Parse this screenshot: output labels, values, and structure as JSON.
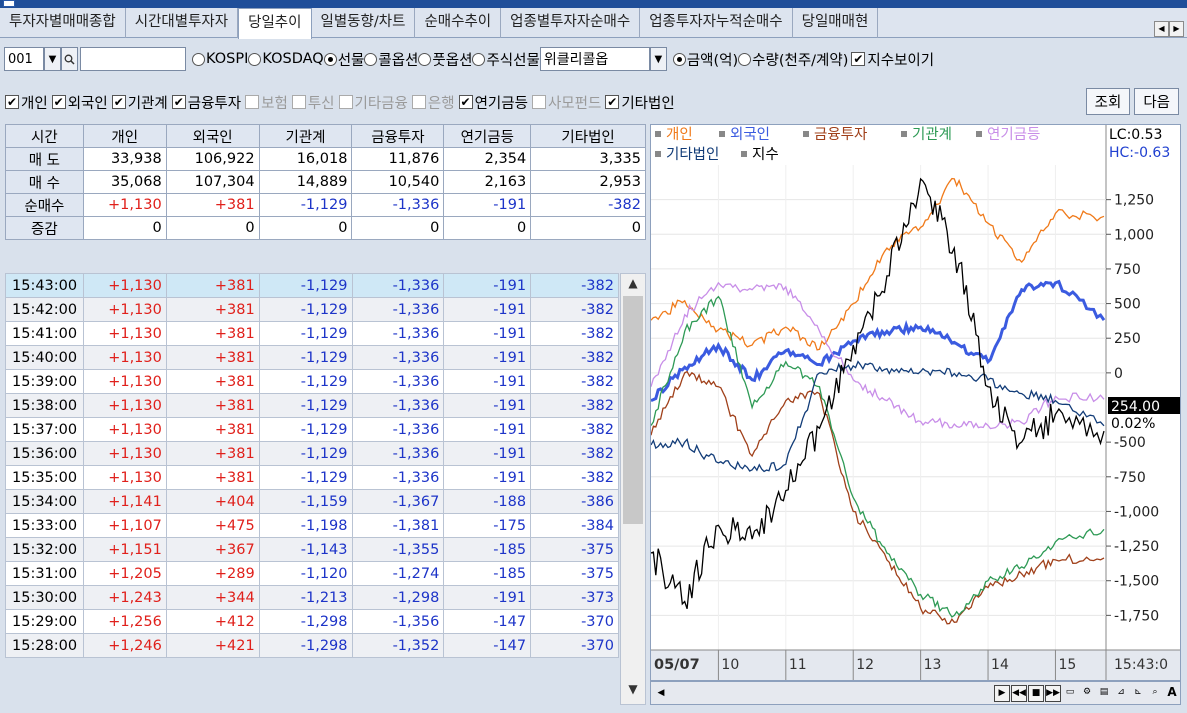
{
  "tabs": [
    "투자자별매매종합",
    "시간대별투자자",
    "당일추이",
    "일별동향/차트",
    "순매수추이",
    "업종별투자자순매수",
    "업종투자자누적순매수",
    "당일매매현"
  ],
  "active_tab_index": 2,
  "controls": {
    "code_value": "001",
    "code_name_value": "",
    "market_radios": [
      {
        "label": "KOSPI",
        "checked": false
      },
      {
        "label": "KOSDAQ",
        "checked": false
      },
      {
        "label": "선물",
        "checked": true
      },
      {
        "label": "콜옵션",
        "checked": false
      },
      {
        "label": "풋옵션",
        "checked": false
      },
      {
        "label": "주식선물",
        "checked": false
      }
    ],
    "weekly_select_value": "위클리콜옵",
    "unit_radios": [
      {
        "label": "금액(억)",
        "checked": true
      },
      {
        "label": "수량(천주/계약)",
        "checked": false
      }
    ],
    "show_index_label": "지수보이기",
    "show_index_checked": true
  },
  "investor_checks": [
    {
      "label": "개인",
      "checked": true
    },
    {
      "label": "외국인",
      "checked": true
    },
    {
      "label": "기관계",
      "checked": true
    },
    {
      "label": "금융투자",
      "checked": true
    },
    {
      "label": "보험",
      "checked": false
    },
    {
      "label": "투신",
      "checked": false
    },
    {
      "label": "기타금융",
      "checked": false
    },
    {
      "label": "은행",
      "checked": false
    },
    {
      "label": "연기금등",
      "checked": true
    },
    {
      "label": "사모펀드",
      "checked": false
    },
    {
      "label": "기타법인",
      "checked": true
    }
  ],
  "buttons": {
    "query": "조회",
    "next": "다음"
  },
  "summary": {
    "headers": [
      "시간",
      "개인",
      "외국인",
      "기관계",
      "금융투자",
      "연기금등",
      "기타법인"
    ],
    "rows": [
      {
        "label": "매 도",
        "values": [
          "33,938",
          "106,922",
          "16,018",
          "11,876",
          "2,354",
          "3,335"
        ]
      },
      {
        "label": "매 수",
        "values": [
          "35,068",
          "107,304",
          "14,889",
          "10,540",
          "2,163",
          "2,953"
        ]
      },
      {
        "label": "순매수",
        "values": [
          "+1,130",
          "+381",
          "-1,129",
          "-1,336",
          "-191",
          "-382"
        ]
      },
      {
        "label": "증감",
        "values": [
          "0",
          "0",
          "0",
          "0",
          "0",
          "0"
        ]
      }
    ]
  },
  "time_rows": [
    [
      "15:43:00",
      "+1,130",
      "+381",
      "-1,129",
      "-1,336",
      "-191",
      "-382"
    ],
    [
      "15:42:00",
      "+1,130",
      "+381",
      "-1,129",
      "-1,336",
      "-191",
      "-382"
    ],
    [
      "15:41:00",
      "+1,130",
      "+381",
      "-1,129",
      "-1,336",
      "-191",
      "-382"
    ],
    [
      "15:40:00",
      "+1,130",
      "+381",
      "-1,129",
      "-1,336",
      "-191",
      "-382"
    ],
    [
      "15:39:00",
      "+1,130",
      "+381",
      "-1,129",
      "-1,336",
      "-191",
      "-382"
    ],
    [
      "15:38:00",
      "+1,130",
      "+381",
      "-1,129",
      "-1,336",
      "-191",
      "-382"
    ],
    [
      "15:37:00",
      "+1,130",
      "+381",
      "-1,129",
      "-1,336",
      "-191",
      "-382"
    ],
    [
      "15:36:00",
      "+1,130",
      "+381",
      "-1,129",
      "-1,336",
      "-191",
      "-382"
    ],
    [
      "15:35:00",
      "+1,130",
      "+381",
      "-1,129",
      "-1,336",
      "-191",
      "-382"
    ],
    [
      "15:34:00",
      "+1,141",
      "+404",
      "-1,159",
      "-1,367",
      "-188",
      "-386"
    ],
    [
      "15:33:00",
      "+1,107",
      "+475",
      "-1,198",
      "-1,381",
      "-175",
      "-384"
    ],
    [
      "15:32:00",
      "+1,151",
      "+367",
      "-1,143",
      "-1,355",
      "-185",
      "-375"
    ],
    [
      "15:31:00",
      "+1,205",
      "+289",
      "-1,120",
      "-1,274",
      "-185",
      "-375"
    ],
    [
      "15:30:00",
      "+1,243",
      "+344",
      "-1,213",
      "-1,298",
      "-191",
      "-373"
    ],
    [
      "15:29:00",
      "+1,256",
      "+412",
      "-1,298",
      "-1,356",
      "-147",
      "-370"
    ],
    [
      "15:28:00",
      "+1,246",
      "+421",
      "-1,298",
      "-1,352",
      "-147",
      "-370"
    ]
  ],
  "chart_data": {
    "type": "line",
    "legend": [
      {
        "name": "개인",
        "color": "#f07a1a"
      },
      {
        "name": "외국인",
        "color": "#3b5be0"
      },
      {
        "name": "금융투자",
        "color": "#a0401a"
      },
      {
        "name": "기관계",
        "color": "#2e9a55"
      },
      {
        "name": "연기금등",
        "color": "#c88ee8"
      },
      {
        "name": "기타법인",
        "color": "#123c78"
      },
      {
        "name": "지수",
        "color": "#000000"
      }
    ],
    "lc_label": "LC:0.53",
    "hc_label": "HC:-0.63",
    "y_ticks": [
      "1,250",
      "1,000",
      "750",
      "500",
      "250",
      "0",
      "-500",
      "-750",
      "-1,000",
      "-1,250",
      "-1,500",
      "-1,750"
    ],
    "y_tick_values": [
      1250,
      1000,
      750,
      500,
      250,
      0,
      -500,
      -750,
      -1000,
      -1250,
      -1500,
      -1750
    ],
    "current_value_label": "254.00",
    "current_pct_label": "0.02%",
    "date_label": "05/07",
    "x_ticks": [
      "10",
      "11",
      "12",
      "13",
      "14",
      "15"
    ],
    "time_label": "15:43:0",
    "ylim": [
      -2000,
      1500
    ],
    "x_hours": [
      9,
      9.5,
      10,
      10.5,
      11,
      11.5,
      12,
      12.5,
      13,
      13.5,
      14,
      14.5,
      15,
      15.72
    ],
    "series": [
      {
        "name": "개인",
        "color": "#f07a1a",
        "values": [
          380,
          520,
          310,
          200,
          330,
          170,
          500,
          900,
          1050,
          1400,
          1080,
          800,
          1150,
          1130
        ]
      },
      {
        "name": "외국인",
        "color": "#3b5be0",
        "values": [
          -200,
          40,
          200,
          -50,
          160,
          60,
          230,
          300,
          330,
          220,
          80,
          600,
          650,
          381
        ]
      },
      {
        "name": "금융투자",
        "color": "#a0401a",
        "values": [
          -450,
          0,
          -100,
          -600,
          -200,
          -150,
          -1000,
          -1350,
          -1700,
          -1800,
          -1550,
          -1450,
          -1350,
          -1336
        ]
      },
      {
        "name": "기관계",
        "color": "#2e9a55",
        "values": [
          -380,
          300,
          550,
          -250,
          80,
          -100,
          -900,
          -1300,
          -1600,
          -1750,
          -1500,
          -1400,
          -1220,
          -1129
        ]
      },
      {
        "name": "연기금등",
        "color": "#c88ee8",
        "values": [
          -100,
          420,
          650,
          600,
          620,
          300,
          -50,
          -200,
          -350,
          -370,
          -380,
          -360,
          -170,
          -191
        ]
      },
      {
        "name": "기타법인",
        "color": "#123c78",
        "values": [
          -520,
          -500,
          -650,
          -700,
          -660,
          0,
          50,
          30,
          10,
          -5,
          -50,
          -150,
          -200,
          -382
        ]
      },
      {
        "name": "지수",
        "color": "#000000",
        "values": [
          -1300,
          -1650,
          -1100,
          -1200,
          -850,
          -400,
          200,
          700,
          1400,
          900,
          -100,
          -500,
          -300,
          -420
        ]
      }
    ]
  }
}
